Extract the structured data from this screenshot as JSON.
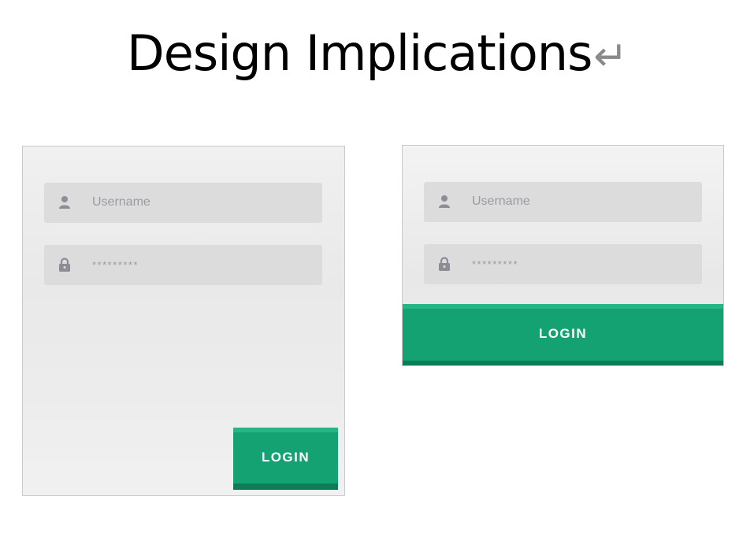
{
  "slide": {
    "title": "Design Implications",
    "return_mark": "↵"
  },
  "mockups": {
    "left": {
      "username_placeholder": "Username",
      "password_placeholder": "*********",
      "login_label": "LOGIN"
    },
    "right": {
      "username_placeholder": "Username",
      "password_placeholder": "*********",
      "login_label": "LOGIN"
    }
  },
  "colors": {
    "accent": "#15a272",
    "field_bg": "#dcdcdd",
    "placeholder_text": "#9a9aa2"
  }
}
